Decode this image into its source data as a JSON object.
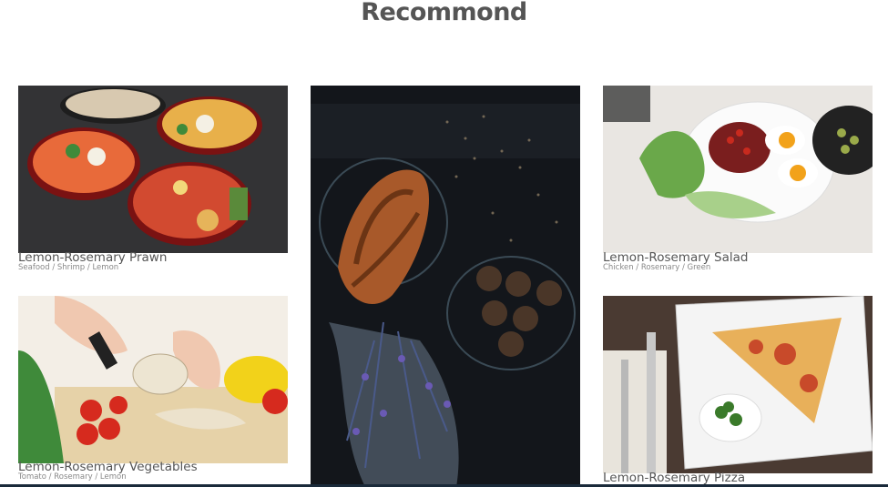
{
  "section": {
    "title": "Recommond"
  },
  "cards": [
    {
      "title": "Lemon-Rosemary Prawn",
      "tags": "Seafood / Shrimp / Lemon",
      "image": "bento-platters-photo"
    },
    {
      "title": "Lemon-Rosemary Salad",
      "tags": "Chicken / Rosemary / Green",
      "image": "salad-eggs-photo"
    },
    {
      "title": "Lemon-Rosemary Vegetables",
      "tags": "Tomato / Rosemary / Lemon",
      "image": "chopping-vegetables-photo"
    },
    {
      "title": "Lemon-Rosemary Pizza",
      "tags": "",
      "image": "pizza-slice-photo"
    },
    {
      "title": "",
      "tags": "",
      "image": "croissant-photo"
    }
  ]
}
